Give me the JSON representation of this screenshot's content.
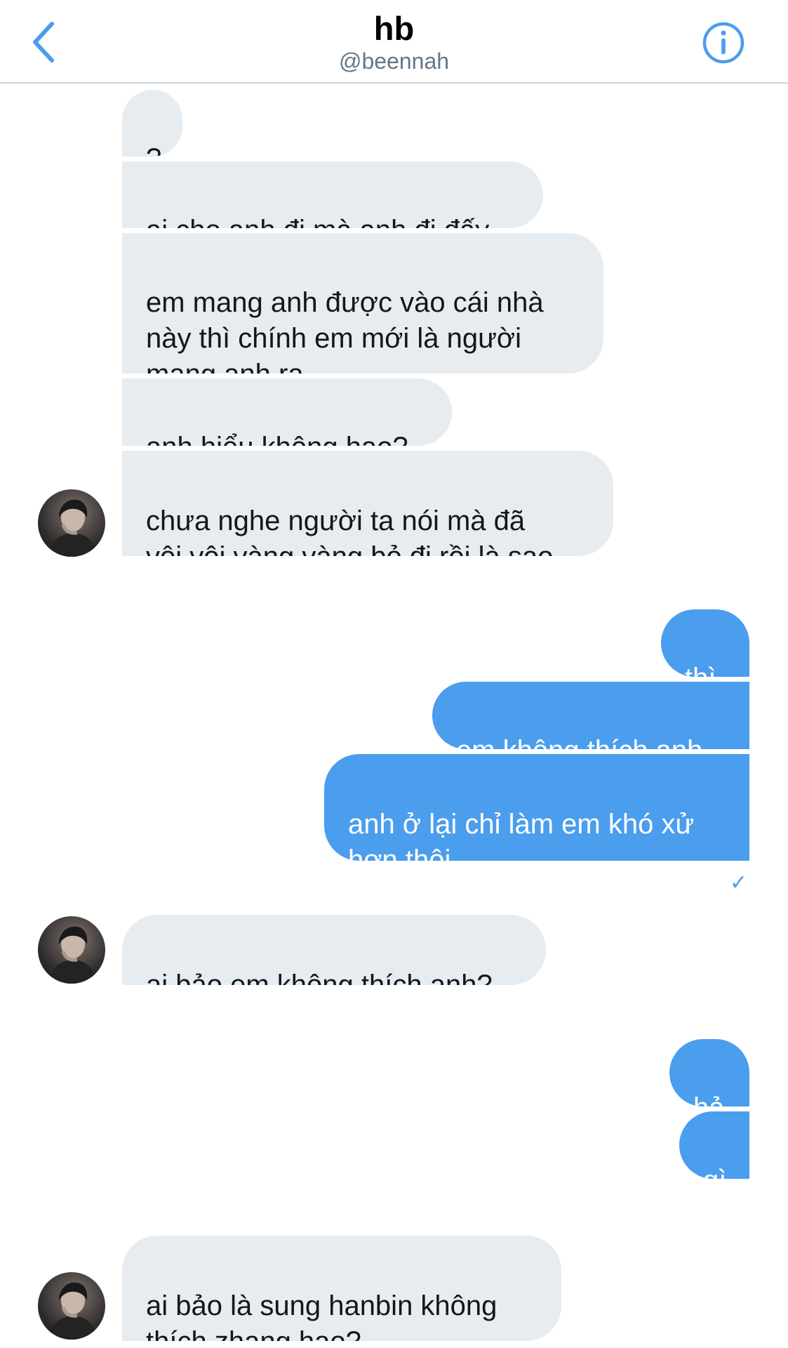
{
  "header": {
    "title": "hb",
    "handle": "@beennah",
    "back_icon": "chevron-left-icon",
    "info_icon": "info-icon",
    "accent_color": "#4b9ded"
  },
  "messages": [
    {
      "side": "incoming",
      "text": "?"
    },
    {
      "side": "incoming",
      "text": "ai cho anh đi mà anh đi đấy"
    },
    {
      "side": "incoming",
      "text": "em mang anh được vào cái nhà\nnày thì chính em mới là người\nmang anh ra"
    },
    {
      "side": "incoming",
      "text": "anh hiểu không hạo?"
    },
    {
      "side": "incoming",
      "text": "chưa nghe người ta nói mà đã\nvội vội vàng vàng bỏ đi rồi là sao"
    },
    {
      "side": "outgoing",
      "text": "thì"
    },
    {
      "side": "outgoing",
      "text": "em không thích anh"
    },
    {
      "side": "outgoing",
      "text": "anh ở lại chỉ làm em khó xử\nhơn thôi..."
    },
    {
      "side": "incoming",
      "text": "ai bảo em không thích anh?"
    },
    {
      "side": "outgoing",
      "text": "hả"
    },
    {
      "side": "outgoing",
      "text": "gì"
    },
    {
      "side": "incoming",
      "text": "ai bảo là sung hanbin không\nthích zhang hao?"
    }
  ],
  "read_receipt_icon": "checkmark-icon",
  "bubble_colors": {
    "incoming": "#e6ecf0",
    "outgoing": "#4b9ded"
  }
}
